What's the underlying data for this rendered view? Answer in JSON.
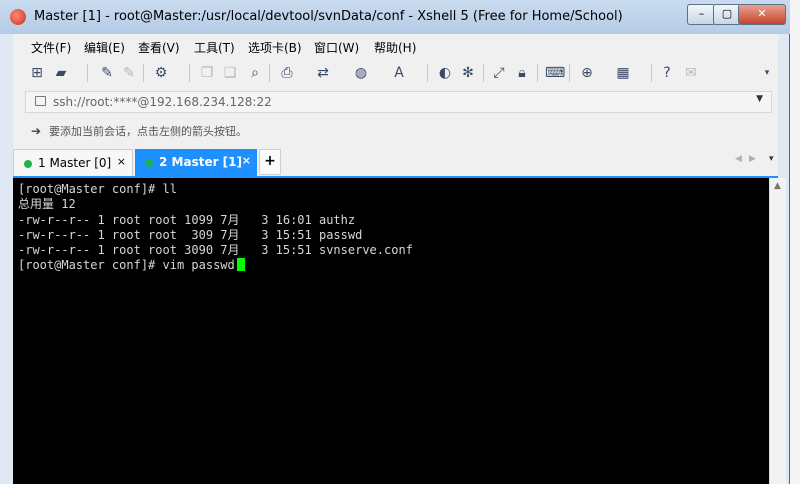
{
  "window": {
    "title": "Master [1] - root@Master:/usr/local/devtool/svnData/conf - Xshell 5 (Free for Home/School)"
  },
  "window_controls": {
    "minimize": "–",
    "maximize": "▢",
    "close": "✕"
  },
  "menu": [
    {
      "label": "文件(F)"
    },
    {
      "label": "编辑(E)"
    },
    {
      "label": "查看(V)"
    },
    {
      "label": "工具(T)"
    },
    {
      "label": "选项卡(B)"
    },
    {
      "label": "窗口(W)"
    },
    {
      "label": "帮助(H)"
    }
  ],
  "toolbar_icons": [
    "new-session-icon",
    "open-folder-icon",
    "connect-icon",
    "disconnect-icon",
    "properties-icon",
    "copy-icon",
    "paste-icon",
    "find-icon",
    "print-icon",
    "transfer-icon",
    "globe-icon",
    "font-icon",
    "xftp-icon",
    "xmanager-icon",
    "fullscreen-icon",
    "lock-icon",
    "keyboard-icon",
    "compose-icon",
    "layout-icon",
    "help-icon",
    "chat-icon"
  ],
  "address_bar": {
    "text": "ssh://root:****@192.168.234.128:22"
  },
  "hint_bar": {
    "text": "要添加当前会话，点击左侧的箭头按钮。"
  },
  "tabs": [
    {
      "label": "1 Master [0]",
      "close": "×",
      "active": false,
      "status_color": "#22b14c"
    },
    {
      "label": "2 Master [1]",
      "close": "×",
      "active": true,
      "status_color": "#22b14c"
    }
  ],
  "tab_add": "+",
  "terminal": {
    "lines": [
      "[root@Master conf]# ll",
      "总用量 12",
      "-rw-r--r-- 1 root root 1099 7月   3 16:01 authz",
      "-rw-r--r-- 1 root root  309 7月   3 15:51 passwd",
      "-rw-r--r-- 1 root root 3090 7月   3 15:51 svnserve.conf"
    ],
    "prompt_line": "[root@Master conf]# vim passwd",
    "background": "#000000",
    "cursor_color": "#00ff00"
  },
  "colors": {
    "accent": "#1e90ff",
    "title_bar": "#c9dbef"
  }
}
